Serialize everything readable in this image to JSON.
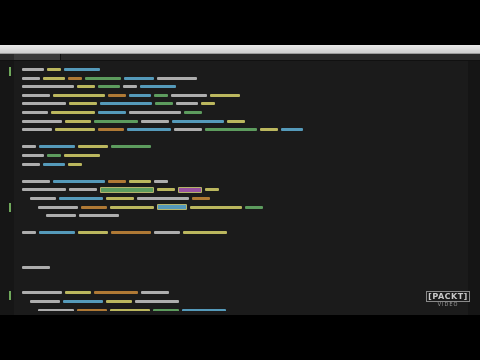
{
  "logo": {
    "brand": "[PACKT]",
    "sub": "VIDEO"
  },
  "colors": {
    "background": "#1b1b1b",
    "keyword": "#c7c7c7",
    "string": "#d7d26a",
    "function": "#5fb0d6",
    "type": "#69b36a",
    "param": "#c98a3a",
    "accent": "#b05bb8"
  },
  "editor": {
    "code_legible": false,
    "lines": [
      [
        "keyword",
        "string",
        "function"
      ],
      [
        "keyword",
        "string",
        "param",
        "type",
        "function",
        "keyword"
      ],
      [
        "keyword",
        "string",
        "type",
        "keyword",
        "function"
      ],
      [
        "keyword",
        "string",
        "param",
        "function",
        "type",
        "keyword",
        "string"
      ],
      [
        "keyword",
        "string",
        "function",
        "type",
        "keyword",
        "string"
      ],
      [
        "keyword",
        "string",
        "function",
        "keyword",
        "type"
      ],
      [
        "keyword",
        "string",
        "type",
        "keyword",
        "function",
        "string"
      ],
      [
        "keyword",
        "string",
        "param",
        "function",
        "keyword",
        "type",
        "string",
        "function"
      ],
      [
        "blank"
      ],
      [
        "keyword",
        "function",
        "string",
        "type"
      ],
      [
        "keyword",
        "type",
        "string"
      ],
      [
        "keyword",
        "function",
        "string"
      ],
      [
        "blank"
      ],
      [
        "keyword",
        "function",
        "param",
        "string",
        "keyword"
      ],
      [
        "keyword",
        "keyword",
        "type",
        "string",
        "accent",
        "string"
      ],
      [
        "keyword",
        "function",
        "string",
        "keyword",
        "param"
      ],
      [
        "keyword",
        "param",
        "string",
        "function",
        "string",
        "type"
      ],
      [
        "keyword",
        "keyword"
      ],
      [
        "blank"
      ],
      [
        "keyword",
        "function",
        "string",
        "param",
        "keyword",
        "string"
      ],
      [
        "blank"
      ],
      [
        "blank"
      ],
      [
        "blank"
      ],
      [
        "keyword"
      ],
      [
        "blank"
      ],
      [
        "blank"
      ],
      [
        "keyword",
        "string",
        "param",
        "keyword"
      ],
      [
        "keyword",
        "function",
        "string",
        "keyword"
      ],
      [
        "keyword",
        "param",
        "string",
        "type",
        "function"
      ],
      [
        "keyword",
        "keyword"
      ]
    ]
  }
}
